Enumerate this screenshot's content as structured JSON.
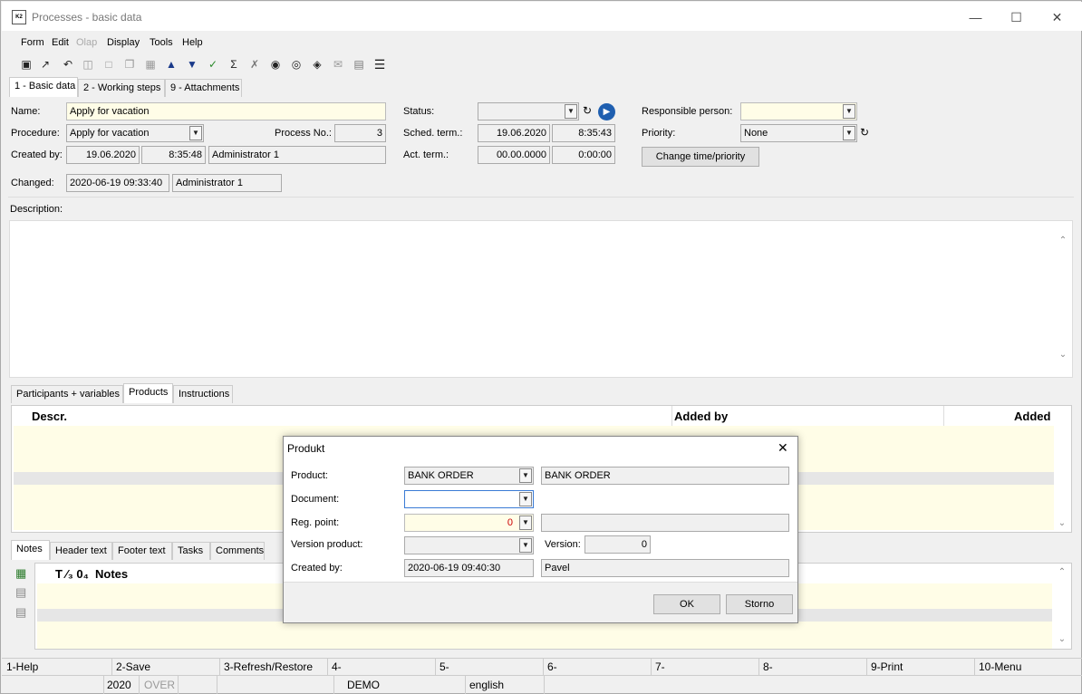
{
  "window": {
    "title": "Processes - basic data",
    "minimize": "—",
    "maximize": "☐",
    "close": "✕"
  },
  "menu": [
    "Form",
    "Edit",
    "Olap",
    "Display",
    "Tools",
    "Help"
  ],
  "tabs": [
    "1 - Basic data",
    "2 - Working steps",
    "9 - Attachments"
  ],
  "form": {
    "name_label": "Name:",
    "name_value": "Apply for vacation",
    "procedure_label": "Procedure:",
    "procedure_value": "Apply for vacation",
    "process_no_label": "Process No.:",
    "process_no_value": "3",
    "created_by_label": "Created by:",
    "created_date": "19.06.2020",
    "created_time": "8:35:48",
    "created_user": "Administrator 1",
    "changed_label": "Changed:",
    "changed_datetime": "2020-06-19 09:33:40",
    "changed_user": "Administrator 1",
    "status_label": "Status:",
    "status_value": "",
    "sched_label": "Sched. term.:",
    "sched_date": "19.06.2020",
    "sched_time": "8:35:43",
    "act_label": "Act. term.:",
    "act_date": "00.00.0000",
    "act_time": "0:00:00",
    "responsible_label": "Responsible person:",
    "responsible_value": "",
    "priority_label": "Priority:",
    "priority_value": "None",
    "change_btn": "Change time/priority",
    "description_label": "Description:"
  },
  "subtabs": [
    "Participants + variables",
    "Products",
    "Instructions"
  ],
  "products_grid": {
    "col1": "Descr.",
    "col2": "Added by",
    "col3": "Added"
  },
  "notes_tabs": [
    "Notes",
    "Header text",
    "Footer text",
    "Tasks",
    "Comments"
  ],
  "notes_grid": {
    "col_icons": "T ⁄₃ 0₄",
    "col_notes": "Notes"
  },
  "fnkeys": [
    "1-Help",
    "2-Save",
    "3-Refresh/Restore",
    "4-",
    "5-",
    "6-",
    "7-",
    "8-",
    "9-Print",
    "10-Menu"
  ],
  "statusbar": {
    "year": "2020",
    "mode": "OVER",
    "demo": "DEMO",
    "lang": "english"
  },
  "dialog": {
    "title": "Produkt",
    "product_label": "Product:",
    "product_value": "BANK ORDER",
    "product_desc": "BANK ORDER",
    "document_label": "Document:",
    "document_value": "",
    "regpoint_label": "Reg. point:",
    "regpoint_value": "0",
    "regpoint_desc": "",
    "version_product_label": "Version product:",
    "version_product_value": "",
    "version_label": "Version:",
    "version_value": "0",
    "created_by_label": "Created by:",
    "created_datetime": "2020-06-19 09:40:30",
    "created_user": "Pavel",
    "ok": "OK",
    "storno": "Storno"
  }
}
